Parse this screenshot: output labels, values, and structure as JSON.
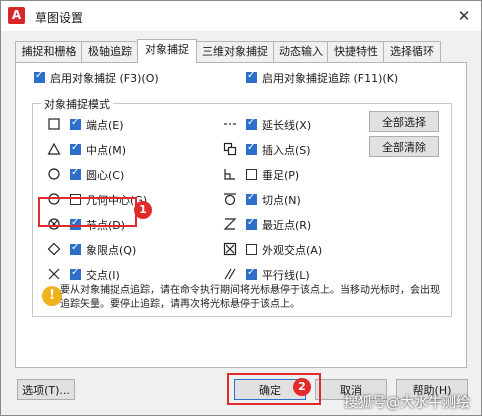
{
  "window": {
    "title": "草图设置",
    "app_icon": "A",
    "close_glyph": "✕"
  },
  "tabs": [
    {
      "label": "捕捉和栅格",
      "active": false
    },
    {
      "label": "极轴追踪",
      "active": false
    },
    {
      "label": "对象捕捉",
      "active": true
    },
    {
      "label": "三维对象捕捉",
      "active": false
    },
    {
      "label": "动态输入",
      "active": false
    },
    {
      "label": "快捷特性",
      "active": false
    },
    {
      "label": "选择循环",
      "active": false
    }
  ],
  "options": {
    "enable_osnap": {
      "label": "启用对象捕捉 (F3)(O)",
      "checked": true
    },
    "enable_tracking": {
      "label": "启用对象捕捉追踪 (F11)(K)",
      "checked": true
    }
  },
  "group_title": "对象捕捉模式",
  "modes": [
    {
      "label": "端点(E)",
      "checked": true,
      "icon": "square-icon"
    },
    {
      "label": "中点(M)",
      "checked": true,
      "icon": "triangle-icon"
    },
    {
      "label": "圆心(C)",
      "checked": true,
      "icon": "circle-icon"
    },
    {
      "label": "几何中心(G)",
      "checked": false,
      "icon": "circle-icon"
    },
    {
      "label": "节点(D)",
      "checked": true,
      "icon": "node-icon"
    },
    {
      "label": "象限点(Q)",
      "checked": true,
      "icon": "diamond-icon"
    },
    {
      "label": "交点(I)",
      "checked": true,
      "icon": "cross-icon"
    },
    {
      "label": "延长线(X)",
      "checked": true,
      "icon": "extension-icon"
    },
    {
      "label": "插入点(S)",
      "checked": true,
      "icon": "insert-icon"
    },
    {
      "label": "垂足(P)",
      "checked": false,
      "icon": "perpendicular-icon"
    },
    {
      "label": "切点(N)",
      "checked": true,
      "icon": "tangent-icon"
    },
    {
      "label": "最近点(R)",
      "checked": true,
      "icon": "nearest-icon"
    },
    {
      "label": "外观交点(A)",
      "checked": false,
      "icon": "apparent-intersection-icon"
    },
    {
      "label": "平行线(L)",
      "checked": true,
      "icon": "parallel-icon"
    }
  ],
  "select_all": "全部选择",
  "clear_all": "全部清除",
  "info_text": "要从对象捕捉点追踪，请在命令执行期间将光标悬停于该点上。当移动光标时，会出现追踪矢量。要停止追踪，请再次将光标悬停于该点上。",
  "footer": {
    "options": "选项(T)...",
    "ok": "确定",
    "cancel": "取消",
    "help": "帮助(H)"
  },
  "annotations": {
    "badge1": "1",
    "badge2": "2"
  },
  "watermark": "搜狐号@大水牛测绘"
}
